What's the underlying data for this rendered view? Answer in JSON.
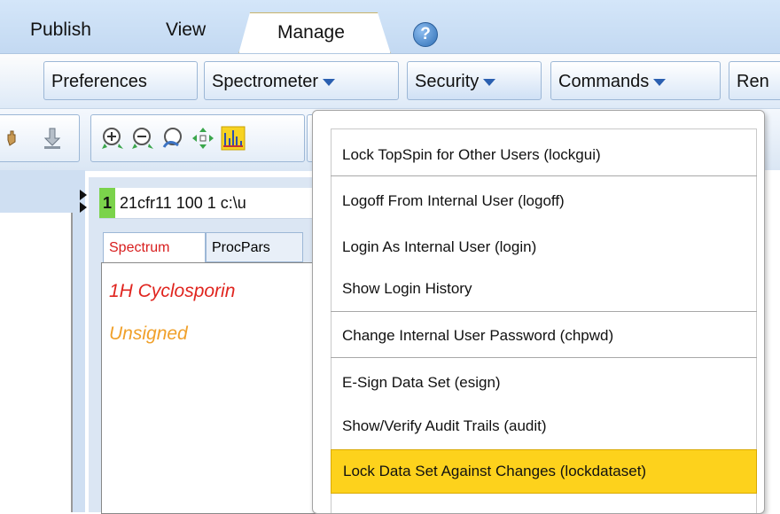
{
  "tabs": {
    "publish": {
      "label": "Publish"
    },
    "view": {
      "label": "View"
    },
    "manage": {
      "label": "Manage"
    }
  },
  "ribbon": {
    "preferences": "Preferences",
    "spectrometer": "Spectrometer",
    "security": "Security",
    "commands": "Commands",
    "remaining": "Ren"
  },
  "dataset": {
    "number": "1",
    "header_text": "21cfr11  100  1  c:\\u",
    "tabs": [
      "Spectrum",
      "ProcPars"
    ],
    "title": "1H Cyclosporin",
    "sign_status": "Unsigned"
  },
  "security_menu": {
    "items": [
      "Lock TopSpin for Other Users (lockgui)",
      "Logoff From Internal User (logoff)",
      "Login As Internal User (login)",
      "Show Login History",
      "Change Internal User Password (chpwd)",
      "E-Sign Data Set (esign)",
      "Show/Verify Audit Trails (audit)",
      "Lock Data Set Against Changes (lockdataset)"
    ],
    "highlighted_index": 7
  },
  "colors": {
    "highlight": "#fdd21c",
    "title_red": "#e0251f",
    "unsigned_orange": "#f0a02a",
    "dataset_number_green": "#7bd34b"
  }
}
